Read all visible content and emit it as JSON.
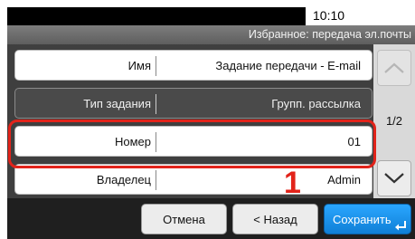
{
  "status": {
    "time": "10:10"
  },
  "header": {
    "title": "Избранное: передача эл.почты"
  },
  "rows": [
    {
      "label": "Имя",
      "value": "Задание передачи - E-mail"
    },
    {
      "label": "Тип задания",
      "value": "Групп. рассылка"
    },
    {
      "label": "Номер",
      "value": "01"
    },
    {
      "label": "Владелец",
      "value": "Admin"
    }
  ],
  "pager": {
    "indicator": "1/2",
    "up_icon": "chevron-up-icon",
    "down_icon": "chevron-down-icon"
  },
  "callout": {
    "number": "1"
  },
  "buttons": {
    "cancel": "Отмена",
    "back": "< Назад",
    "save": "Сохранить"
  },
  "colors": {
    "highlight": "#e2231a",
    "save_button": "#1e90e8"
  }
}
